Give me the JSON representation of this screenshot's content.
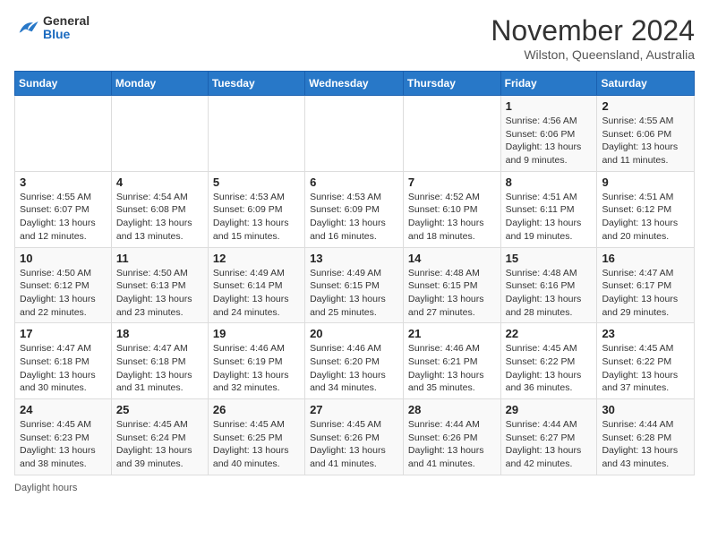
{
  "header": {
    "logo_general": "General",
    "logo_blue": "Blue",
    "month_title": "November 2024",
    "location": "Wilston, Queensland, Australia"
  },
  "days_of_week": [
    "Sunday",
    "Monday",
    "Tuesday",
    "Wednesday",
    "Thursday",
    "Friday",
    "Saturday"
  ],
  "weeks": [
    [
      {
        "day": "",
        "info": ""
      },
      {
        "day": "",
        "info": ""
      },
      {
        "day": "",
        "info": ""
      },
      {
        "day": "",
        "info": ""
      },
      {
        "day": "",
        "info": ""
      },
      {
        "day": "1",
        "info": "Sunrise: 4:56 AM\nSunset: 6:06 PM\nDaylight: 13 hours and 9 minutes."
      },
      {
        "day": "2",
        "info": "Sunrise: 4:55 AM\nSunset: 6:06 PM\nDaylight: 13 hours and 11 minutes."
      }
    ],
    [
      {
        "day": "3",
        "info": "Sunrise: 4:55 AM\nSunset: 6:07 PM\nDaylight: 13 hours and 12 minutes."
      },
      {
        "day": "4",
        "info": "Sunrise: 4:54 AM\nSunset: 6:08 PM\nDaylight: 13 hours and 13 minutes."
      },
      {
        "day": "5",
        "info": "Sunrise: 4:53 AM\nSunset: 6:09 PM\nDaylight: 13 hours and 15 minutes."
      },
      {
        "day": "6",
        "info": "Sunrise: 4:53 AM\nSunset: 6:09 PM\nDaylight: 13 hours and 16 minutes."
      },
      {
        "day": "7",
        "info": "Sunrise: 4:52 AM\nSunset: 6:10 PM\nDaylight: 13 hours and 18 minutes."
      },
      {
        "day": "8",
        "info": "Sunrise: 4:51 AM\nSunset: 6:11 PM\nDaylight: 13 hours and 19 minutes."
      },
      {
        "day": "9",
        "info": "Sunrise: 4:51 AM\nSunset: 6:12 PM\nDaylight: 13 hours and 20 minutes."
      }
    ],
    [
      {
        "day": "10",
        "info": "Sunrise: 4:50 AM\nSunset: 6:12 PM\nDaylight: 13 hours and 22 minutes."
      },
      {
        "day": "11",
        "info": "Sunrise: 4:50 AM\nSunset: 6:13 PM\nDaylight: 13 hours and 23 minutes."
      },
      {
        "day": "12",
        "info": "Sunrise: 4:49 AM\nSunset: 6:14 PM\nDaylight: 13 hours and 24 minutes."
      },
      {
        "day": "13",
        "info": "Sunrise: 4:49 AM\nSunset: 6:15 PM\nDaylight: 13 hours and 25 minutes."
      },
      {
        "day": "14",
        "info": "Sunrise: 4:48 AM\nSunset: 6:15 PM\nDaylight: 13 hours and 27 minutes."
      },
      {
        "day": "15",
        "info": "Sunrise: 4:48 AM\nSunset: 6:16 PM\nDaylight: 13 hours and 28 minutes."
      },
      {
        "day": "16",
        "info": "Sunrise: 4:47 AM\nSunset: 6:17 PM\nDaylight: 13 hours and 29 minutes."
      }
    ],
    [
      {
        "day": "17",
        "info": "Sunrise: 4:47 AM\nSunset: 6:18 PM\nDaylight: 13 hours and 30 minutes."
      },
      {
        "day": "18",
        "info": "Sunrise: 4:47 AM\nSunset: 6:18 PM\nDaylight: 13 hours and 31 minutes."
      },
      {
        "day": "19",
        "info": "Sunrise: 4:46 AM\nSunset: 6:19 PM\nDaylight: 13 hours and 32 minutes."
      },
      {
        "day": "20",
        "info": "Sunrise: 4:46 AM\nSunset: 6:20 PM\nDaylight: 13 hours and 34 minutes."
      },
      {
        "day": "21",
        "info": "Sunrise: 4:46 AM\nSunset: 6:21 PM\nDaylight: 13 hours and 35 minutes."
      },
      {
        "day": "22",
        "info": "Sunrise: 4:45 AM\nSunset: 6:22 PM\nDaylight: 13 hours and 36 minutes."
      },
      {
        "day": "23",
        "info": "Sunrise: 4:45 AM\nSunset: 6:22 PM\nDaylight: 13 hours and 37 minutes."
      }
    ],
    [
      {
        "day": "24",
        "info": "Sunrise: 4:45 AM\nSunset: 6:23 PM\nDaylight: 13 hours and 38 minutes."
      },
      {
        "day": "25",
        "info": "Sunrise: 4:45 AM\nSunset: 6:24 PM\nDaylight: 13 hours and 39 minutes."
      },
      {
        "day": "26",
        "info": "Sunrise: 4:45 AM\nSunset: 6:25 PM\nDaylight: 13 hours and 40 minutes."
      },
      {
        "day": "27",
        "info": "Sunrise: 4:45 AM\nSunset: 6:26 PM\nDaylight: 13 hours and 41 minutes."
      },
      {
        "day": "28",
        "info": "Sunrise: 4:44 AM\nSunset: 6:26 PM\nDaylight: 13 hours and 41 minutes."
      },
      {
        "day": "29",
        "info": "Sunrise: 4:44 AM\nSunset: 6:27 PM\nDaylight: 13 hours and 42 minutes."
      },
      {
        "day": "30",
        "info": "Sunrise: 4:44 AM\nSunset: 6:28 PM\nDaylight: 13 hours and 43 minutes."
      }
    ]
  ],
  "footer": {
    "daylight_label": "Daylight hours"
  }
}
